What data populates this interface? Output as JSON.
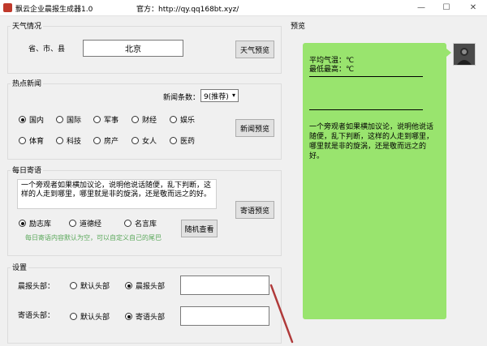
{
  "window": {
    "title": "飘云企业晨报生成器1.0",
    "site": "官方：http://qy.qq168bt.xyz/",
    "min_label": "—",
    "max_label": "☐",
    "close_label": "✕"
  },
  "weather": {
    "group_title": "天气情况",
    "region_label": "省、市、县",
    "city_value": "北京",
    "preview_button": "天气预览"
  },
  "news": {
    "group_title": "热点新闻",
    "count_label": "新闻条数：",
    "count_value": "9(推荐)",
    "categories": [
      {
        "label": "国内",
        "checked": true
      },
      {
        "label": "国际",
        "checked": false
      },
      {
        "label": "军事",
        "checked": false
      },
      {
        "label": "财经",
        "checked": false
      },
      {
        "label": "娱乐",
        "checked": false
      },
      {
        "label": "体育",
        "checked": false
      },
      {
        "label": "科技",
        "checked": false
      },
      {
        "label": "房产",
        "checked": false
      },
      {
        "label": "女人",
        "checked": false
      },
      {
        "label": "医药",
        "checked": false
      }
    ],
    "preview_button": "新闻预览"
  },
  "daily": {
    "group_title": "每日寄语",
    "text": "一个旁观者如果横加议论，说明他说话随便，乱下判断，这样的人走到哪里，哪里就是非的旋涡，还是敬而远之的好。",
    "sources": [
      {
        "label": "励志库",
        "checked": true
      },
      {
        "label": "道德经",
        "checked": false
      },
      {
        "label": "名言库",
        "checked": false
      }
    ],
    "random_button": "随机查看",
    "preview_button": "寄语预览",
    "hint": "每日寄语内容默认为空，可以自定义自己的尾巴",
    "hint_color": "#5aa85a"
  },
  "settings": {
    "group_title": "设置",
    "morning_label": "晨报头部：",
    "morning_options": [
      {
        "label": "默认头部",
        "checked": false
      },
      {
        "label": "晨报头部",
        "checked": true
      }
    ],
    "morning_value": "",
    "message_label": "寄语头部：",
    "message_options": [
      {
        "label": "默认头部",
        "checked": false
      },
      {
        "label": "寄语头部",
        "checked": true
      }
    ],
    "message_value": ""
  },
  "preview": {
    "group_title": "预览",
    "avg_temp": "平均气温：℃",
    "range_temp": "最低最高：℃",
    "quote": "一个旁观者如果横加议论，说明他说话随便，乱下判断，这样的人走到哪里，哪里就是非的旋涡，还是敬而远之的好。",
    "bubble_color": "#99e46e"
  }
}
